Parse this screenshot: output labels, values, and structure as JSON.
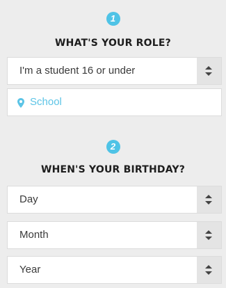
{
  "step1": {
    "number": "1",
    "heading": "WHAT'S YOUR ROLE?"
  },
  "role_select": {
    "value": "I'm a student 16 or under"
  },
  "school_input": {
    "placeholder": "School"
  },
  "step2": {
    "number": "2",
    "heading": "WHEN'S YOUR BIRTHDAY?"
  },
  "day_select": {
    "value": "Day"
  },
  "month_select": {
    "value": "Month"
  },
  "year_select": {
    "value": "Year"
  },
  "colors": {
    "accent": "#4fc3e6",
    "background": "#ededed",
    "select_arrow_bg": "#e4e4e4"
  },
  "icons": {
    "location": "map-pin-icon",
    "select_arrows": "up-down-arrows-icon"
  }
}
